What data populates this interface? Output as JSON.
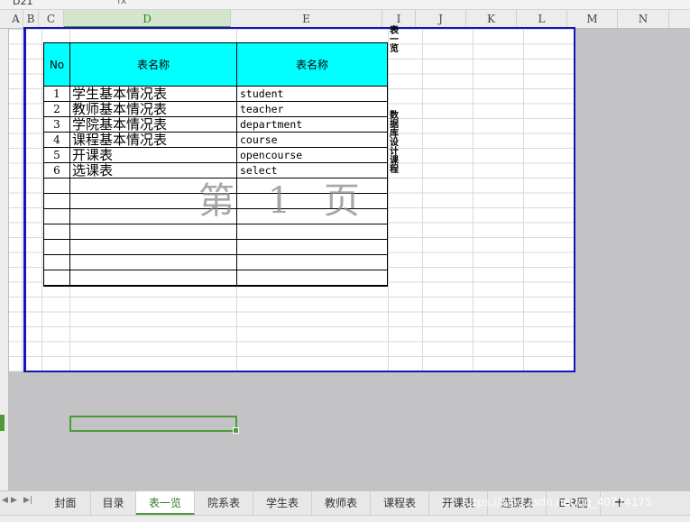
{
  "formula_bar": {
    "cell_ref": "D21",
    "fx_label": "fx"
  },
  "columns": [
    "A",
    "B",
    "C",
    "D",
    "E",
    "I",
    "J",
    "K",
    "L",
    "M",
    "N"
  ],
  "selected_column": "D",
  "table": {
    "headers": {
      "no": "No",
      "col1": "表名称",
      "col2": "表名称"
    },
    "rows": [
      {
        "no": "1",
        "cn": "学生基本情况表",
        "en": "student"
      },
      {
        "no": "2",
        "cn": "教师基本情况表",
        "en": "teacher"
      },
      {
        "no": "3",
        "cn": "学院基本情况表",
        "en": "department"
      },
      {
        "no": "4",
        "cn": "课程基本情况表",
        "en": "course"
      },
      {
        "no": "5",
        "cn": "开课表",
        "en": "opencourse"
      },
      {
        "no": "6",
        "cn": "选课表",
        "en": "select"
      }
    ],
    "empty_rows": 7
  },
  "watermark": "第 1 页",
  "vertical_text_1": "表一览",
  "vertical_text_2": "数据库设计课程",
  "tabs": [
    {
      "label": "封面",
      "active": false
    },
    {
      "label": "目录",
      "active": false
    },
    {
      "label": "表一览",
      "active": true
    },
    {
      "label": "院系表",
      "active": false
    },
    {
      "label": "学生表",
      "active": false
    },
    {
      "label": "教师表",
      "active": false
    },
    {
      "label": "课程表",
      "active": false
    },
    {
      "label": "开课表",
      "active": false
    },
    {
      "label": "选课表",
      "active": false
    },
    {
      "label": "E-R图",
      "active": false
    }
  ],
  "add_tab_symbol": "+",
  "source_watermark": "https://blog.csdn.net/qq_40774175",
  "colors": {
    "accent": "#4c9a3c",
    "header_fill": "#00ffff",
    "page_border": "#1414b8"
  }
}
